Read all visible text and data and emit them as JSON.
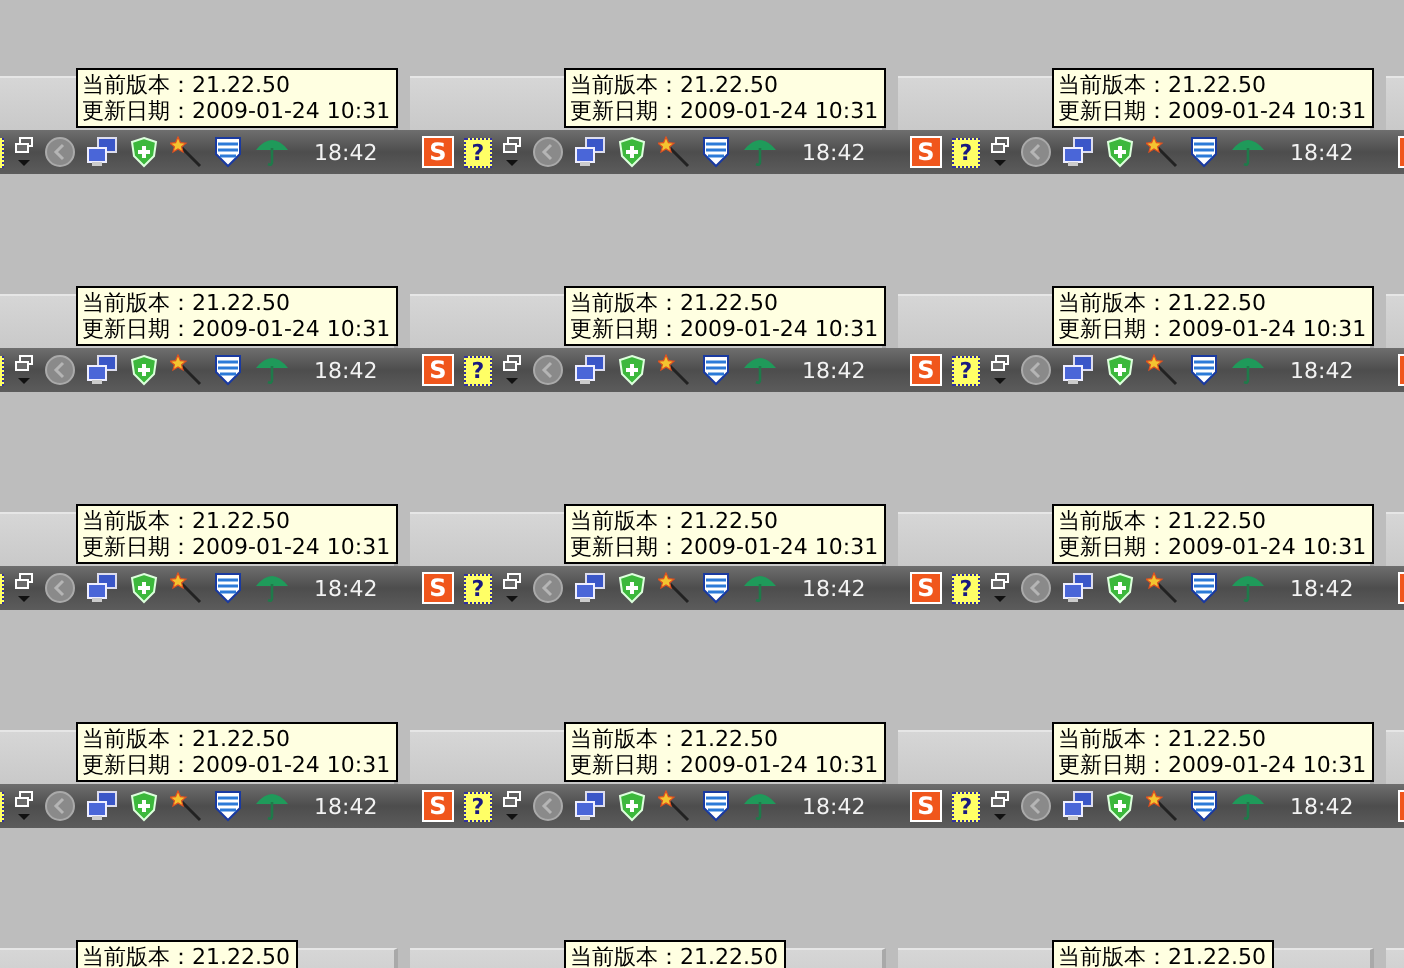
{
  "rows": [
    {
      "tiles": [
        {
          "tooltip": [
            "当前版本：21.22.50",
            "更新日期：2009-01-24 10:31"
          ],
          "clock": "18:42"
        },
        {
          "ime": "S",
          "help": "?",
          "tooltip": [
            "当前版本：21.22.50",
            "更新日期：2009-01-24 10:31"
          ],
          "clock": "18:42"
        },
        {
          "ime": "S",
          "help": "?",
          "tooltip": [
            "当前版本：21.22.50",
            "更新日期：2009-01-24 10:31"
          ],
          "clock": "18:42"
        }
      ]
    },
    {
      "tiles": [
        {
          "tooltip": [
            "当前版本：21.22.50",
            "更新日期：2009-01-24 10:31"
          ],
          "clock": "18:42"
        },
        {
          "ime": "S",
          "help": "?",
          "tooltip": [
            "当前版本：21.22.50",
            "更新日期：2009-01-24 10:31"
          ],
          "clock": "18:42"
        },
        {
          "ime": "S",
          "help": "?",
          "tooltip": [
            "当前版本：21.22.50",
            "更新日期：2009-01-24 10:31"
          ],
          "clock": "18:42"
        }
      ]
    },
    {
      "tiles": [
        {
          "tooltip": [
            "当前版本：21.22.50",
            "更新日期：2009-01-24 10:31"
          ],
          "clock": "18:42"
        },
        {
          "ime": "S",
          "help": "?",
          "tooltip": [
            "当前版本：21.22.50",
            "更新日期：2009-01-24 10:31"
          ],
          "clock": "18:42"
        },
        {
          "ime": "S",
          "help": "?",
          "tooltip": [
            "当前版本：21.22.50",
            "更新日期：2009-01-24 10:31"
          ],
          "clock": "18:42"
        }
      ]
    },
    {
      "tiles": [
        {
          "tooltip": [
            "当前版本：21.22.50",
            "更新日期：2009-01-24 10:31"
          ],
          "clock": "18:42"
        },
        {
          "ime": "S",
          "help": "?",
          "tooltip": [
            "当前版本：21.22.50",
            "更新日期：2009-01-24 10:31"
          ],
          "clock": "18:42"
        },
        {
          "ime": "S",
          "help": "?",
          "tooltip": [
            "当前版本：21.22.50",
            "更新日期：2009-01-24 10:31"
          ],
          "clock": "18:42"
        }
      ]
    },
    {
      "tiles": [
        {
          "tooltip": [
            "当前版本：21.22.50"
          ]
        },
        {
          "tooltip": [
            "当前版本：21.22.50"
          ]
        },
        {
          "tooltip": [
            "当前版本：21.22.50"
          ]
        }
      ]
    }
  ]
}
